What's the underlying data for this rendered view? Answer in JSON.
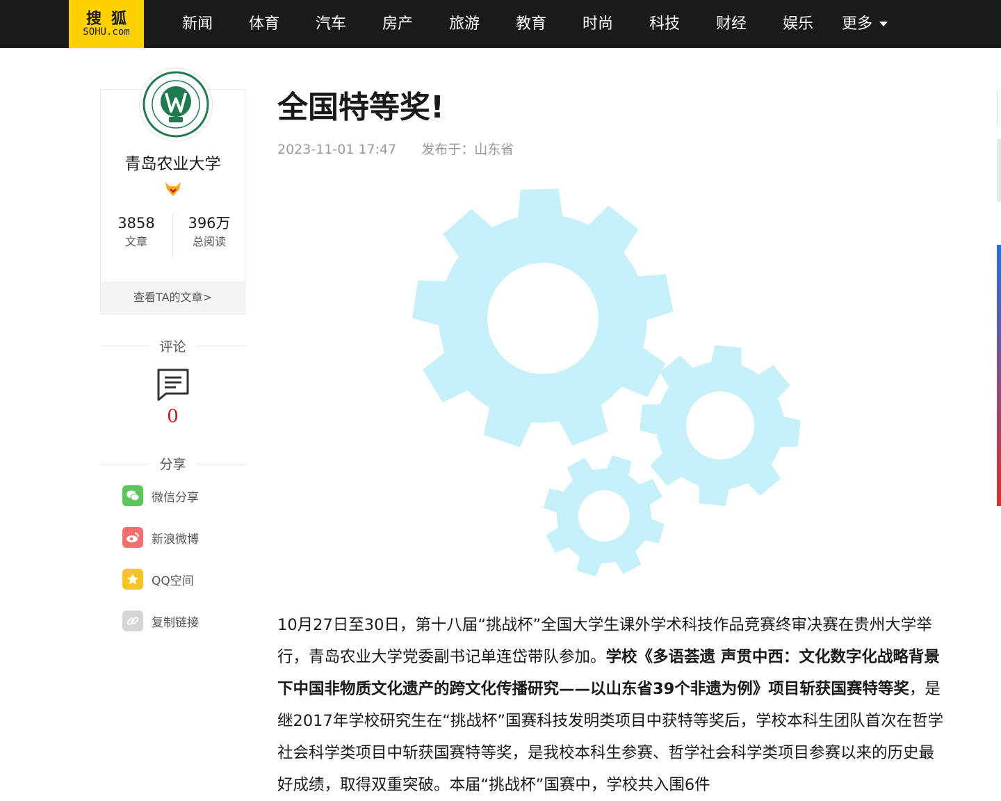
{
  "brand": {
    "logo_cn": "搜狐",
    "logo_en": "SOHU.com"
  },
  "nav": {
    "items": [
      "新闻",
      "体育",
      "汽车",
      "房产",
      "旅游",
      "教育",
      "时尚",
      "科技",
      "财经",
      "娱乐"
    ],
    "more_label": "更多"
  },
  "author": {
    "name": "青岛农业大学",
    "stats": [
      {
        "value": "3858",
        "label": "文章"
      },
      {
        "value": "396万",
        "label": "总阅读"
      }
    ],
    "view_articles_label": "查看TA的文章>"
  },
  "comments": {
    "title": "评论",
    "count": "0"
  },
  "share": {
    "title": "分享",
    "items": [
      {
        "label": "微信分享",
        "icon": "wechat-icon",
        "color": "#5bc75b"
      },
      {
        "label": "新浪微博",
        "icon": "weibo-icon",
        "color": "#f06f6f"
      },
      {
        "label": "QQ空间",
        "icon": "qzone-icon",
        "color": "#f7c325"
      },
      {
        "label": "复制链接",
        "icon": "link-icon",
        "color": "#d6d6d6"
      }
    ]
  },
  "article": {
    "title": "全国特等奖!",
    "date": "2023-11-01 17:47",
    "location": "发布于：山东省",
    "paragraph": {
      "part1": "10月27日至30日，第十八届“挑战杯”全国大学生课外学术科技作品竞赛终审决赛在贵州大学举行，青岛农业大学党委副书记单连岱带队参加。",
      "part2_bold": "学校《多语荟遗 声贯中西：文化数字化战略背景下中国非物质文化遗产的跨文化传播研究——以山东省39个非遗为例》项目斩获国赛特等奖",
      "part3": "，是继2017年学校研究生在“挑战杯”国赛科技发明类项目中获特等奖后，学校本科生团队首次在哲学社会科学类项目中斩获国赛特等奖，是我校本科生参赛、哲学社会科学类项目参赛以来的历史最好成绩，取得双重突破。本届“挑战杯”国赛中，学校共入围6件"
    }
  },
  "colors": {
    "nav_bg": "#1a1a1a",
    "logo_bg": "#ffd100",
    "gear": "#c6f1fa",
    "accent_red": "#c31a1f"
  }
}
